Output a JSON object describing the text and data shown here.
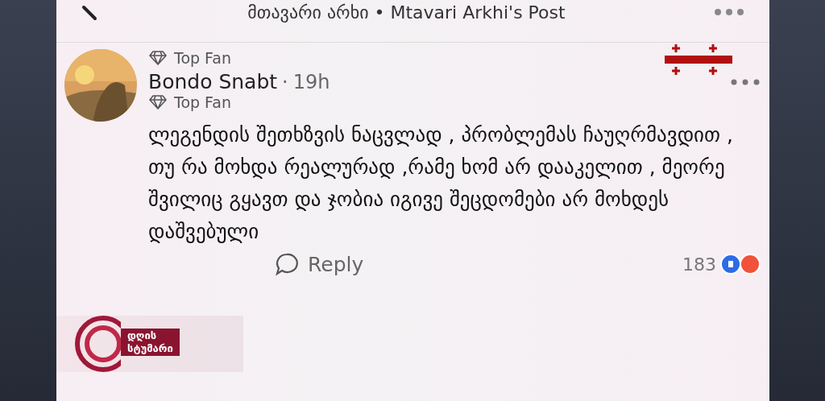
{
  "header": {
    "title": "მთავარი არხი • Mtavari Arkhi's Post"
  },
  "post_badge": {
    "label": "Top Fan"
  },
  "comment": {
    "author": "Bondo Snabt",
    "separator": "·",
    "time": "19h",
    "badge": "Top Fan",
    "text": "ლეგენდის შეთხზვის ნაცვლად , პრობლემას ჩაუღრმავდით , თუ რა მოხდა რეალურად ,რამე ხომ არ დააკელით , მეორე შვილიც გყავთ და ჯობია იგივე შეცდომები არ მოხდეს დაშვებული",
    "reply": "Reply",
    "reaction_count": "183"
  },
  "show_logo": {
    "line_1": "დღის",
    "line_2": "სტუმარი"
  }
}
